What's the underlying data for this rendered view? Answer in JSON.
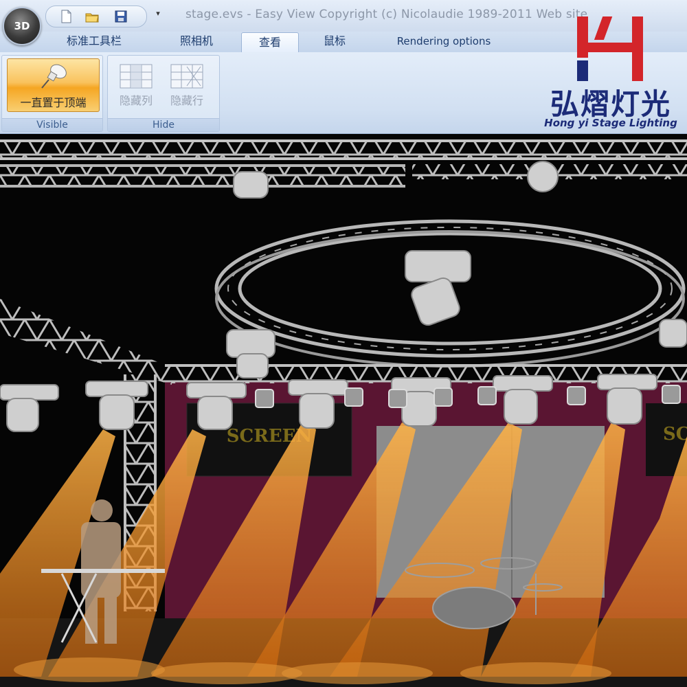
{
  "app": {
    "orb_label": "3D",
    "title": "stage.evs - Easy View    Copyright (c) Nicolaudie 1989-2011    Web site"
  },
  "quick_access": {
    "more_glyph": "▾"
  },
  "tabs": [
    {
      "label": "标准工具栏"
    },
    {
      "label": "照相机"
    },
    {
      "label": "查看"
    },
    {
      "label": "鼠标"
    },
    {
      "label": "Rendering options"
    }
  ],
  "active_tab": "查看",
  "ribbon": {
    "visible_group": {
      "label": "Visible",
      "stay_on_top_label": "一直置于顶端"
    },
    "hide_group": {
      "label": "Hide",
      "hide_columns_label": "隐藏列",
      "hide_rows_label": "隐藏行"
    }
  },
  "logo": {
    "cn": "弘熠灯光",
    "en": "Hong yi Stage Lighting",
    "red": "#d3252a",
    "blue": "#1c2b78"
  },
  "scene": {
    "screen_left": "SCREEN",
    "screen_right": "SC",
    "beam_color": "#f28a17",
    "backdrop_color": "#5a1532"
  },
  "colors": {
    "ribbon_active": "#f5a623",
    "accent": "#1e3d6e"
  }
}
